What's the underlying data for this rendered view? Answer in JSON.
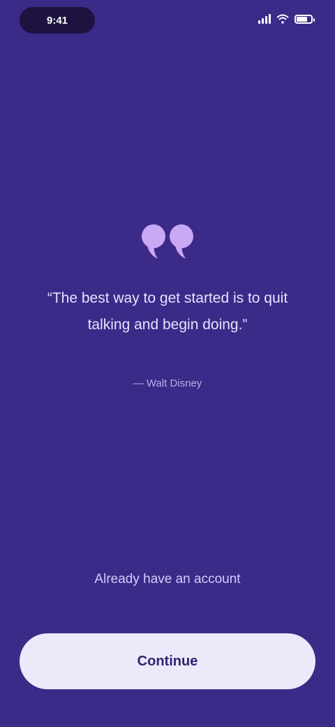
{
  "status_bar": {
    "time": "9:41"
  },
  "quote": {
    "icon": "quote-icon",
    "text": "“The best way to get started is to quit talking and begin doing.”",
    "author": "— Walt Disney"
  },
  "actions": {
    "secondary_label": "Already have an account",
    "primary_label": "Continue"
  },
  "colors": {
    "background": "#3b2a88",
    "quote_icon": "#c9a8f5",
    "button_background": "#ece9fb"
  }
}
